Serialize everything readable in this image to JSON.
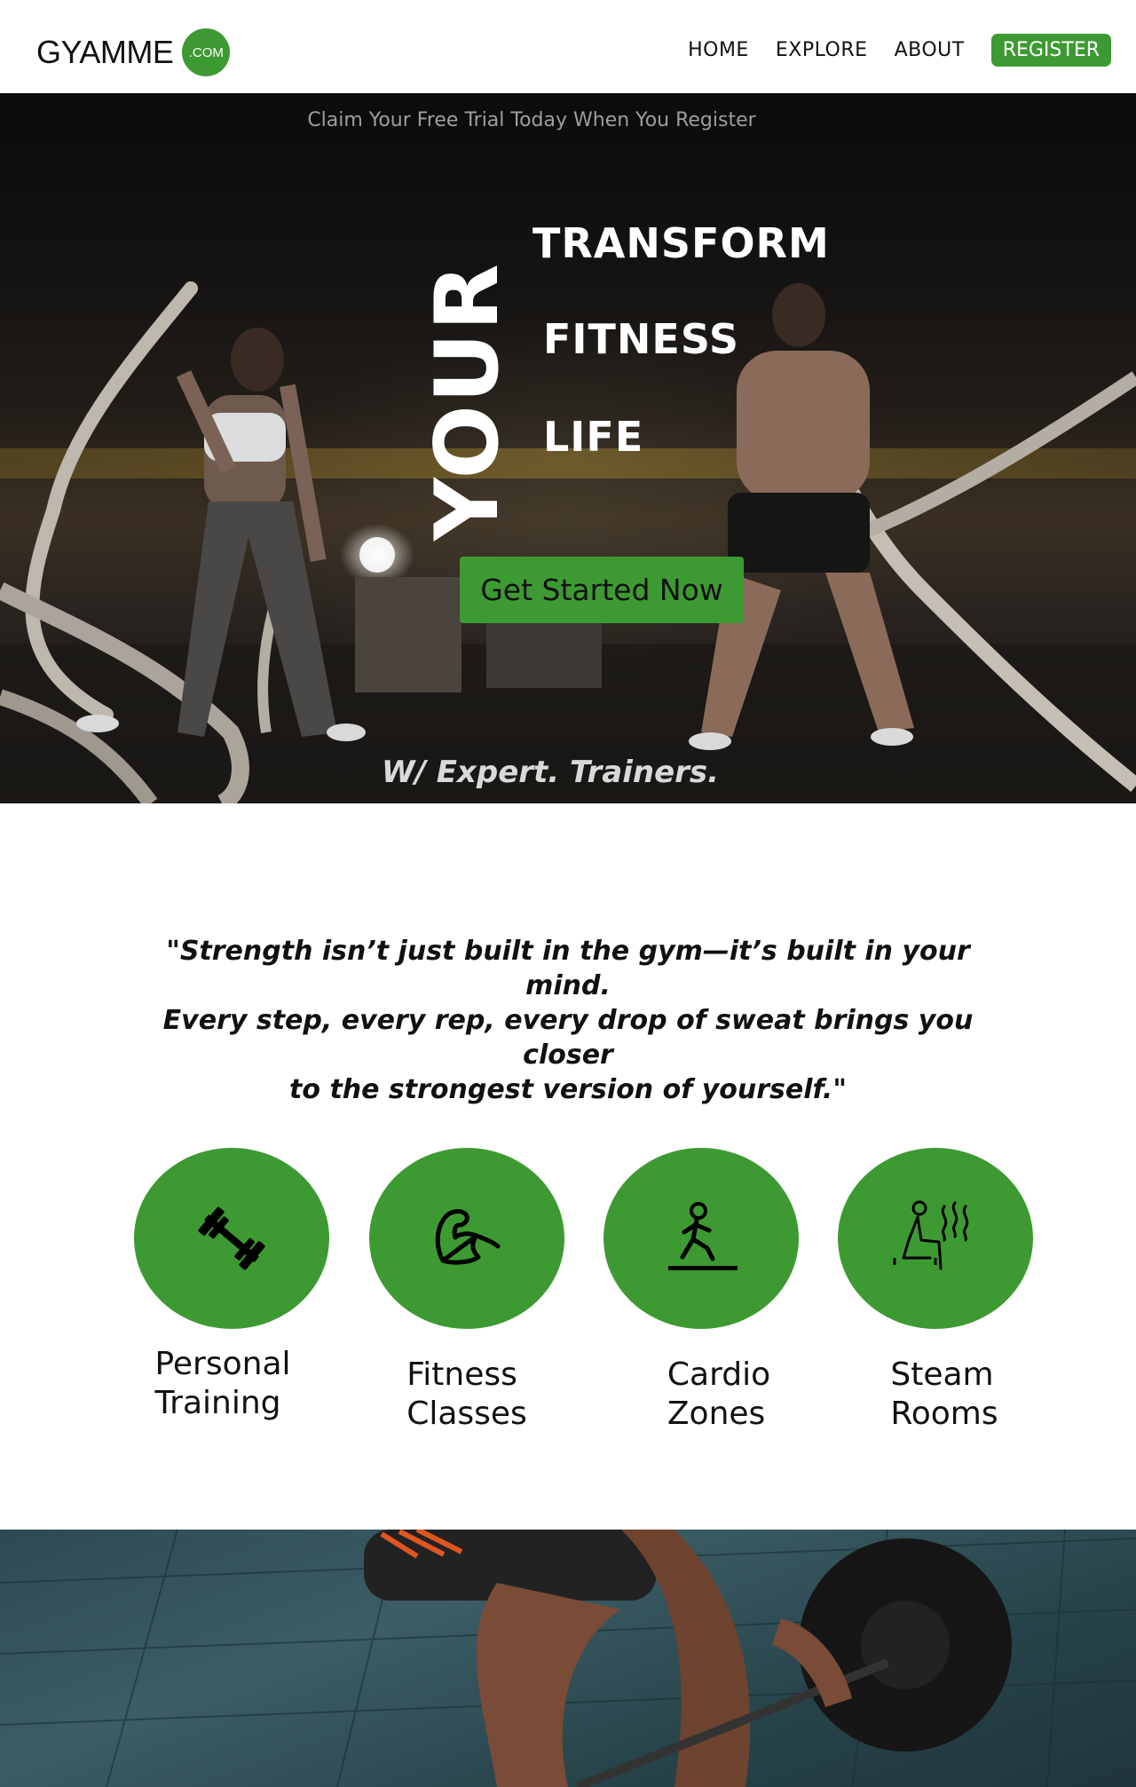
{
  "nav": {
    "logo": "GYAMME",
    "logo_badge": ".COM",
    "links": [
      "HOME",
      "EXPLORE",
      "ABOUT"
    ],
    "register": "REGISTER"
  },
  "hero": {
    "trial": "Claim Your Free Trial Today When You Register",
    "vertical_word": "YOUR",
    "word1": "TRANSFORM",
    "word2": "FITNESS",
    "word3": "LIFE",
    "cta": "Get Started Now",
    "tagline": "W/  Expert. Trainers."
  },
  "quote": {
    "line1": "\"Strength isn’t just built in the gym—it’s built in your mind.",
    "line2": "Every step, every rep, every drop of sweat brings you closer",
    "line3": "to the strongest version of yourself.\""
  },
  "services": [
    {
      "line1": "Personal",
      "line2": "Training",
      "icon": "dumbbell-icon"
    },
    {
      "line1": "Fitness",
      "line2": "Classes",
      "icon": "flexed-arm-icon"
    },
    {
      "line1": "Cardio",
      "line2": "Zones",
      "icon": "treadmill-icon"
    },
    {
      "line1": "Steam",
      "line2": "Rooms",
      "icon": "sauna-icon"
    }
  ],
  "colors": {
    "accent": "#3d9a32",
    "hero_bg": "#141312"
  }
}
